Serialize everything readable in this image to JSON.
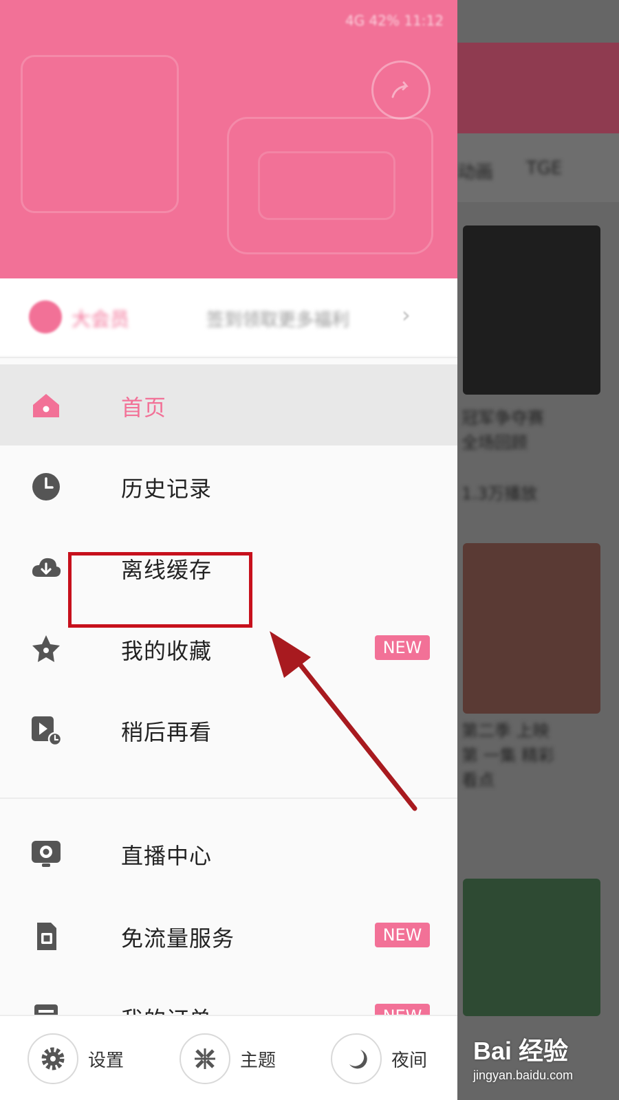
{
  "header": {
    "status_bar_text": "4G 42% 11:12"
  },
  "user": {
    "name": "大会员",
    "link_text": "签到领取更多福利"
  },
  "menu": {
    "items": [
      {
        "label": "首页",
        "icon": "home-icon",
        "active": true
      },
      {
        "label": "历史记录",
        "icon": "history-clock-icon"
      },
      {
        "label": "离线缓存",
        "icon": "cloud-download-icon"
      },
      {
        "label": "我的收藏",
        "icon": "star-icon",
        "badge": "NEW"
      },
      {
        "label": "稍后再看",
        "icon": "watch-later-icon"
      },
      {
        "label": "直播中心",
        "icon": "live-camera-icon"
      },
      {
        "label": "免流量服务",
        "icon": "sim-card-icon",
        "badge": "NEW"
      },
      {
        "label": "我的订单",
        "icon": "order-icon",
        "badge": "NEW"
      }
    ]
  },
  "bottom_bar": {
    "settings_label": "设置",
    "theme_label": "主题",
    "night_label": "夜间"
  },
  "main_content": {
    "tab_1": "动画",
    "tab_2": "TGE",
    "card_1_title": "冠军争夺赛 全场回顾",
    "card_2_title": "第二季 上映第 一集 精彩看点",
    "meta": "1.3万播放"
  },
  "watermark": {
    "brand": "Bai  经验",
    "url": "jingyan.baidu.com"
  },
  "colors": {
    "accent": "#f27197",
    "annotation": "#c7101c"
  }
}
